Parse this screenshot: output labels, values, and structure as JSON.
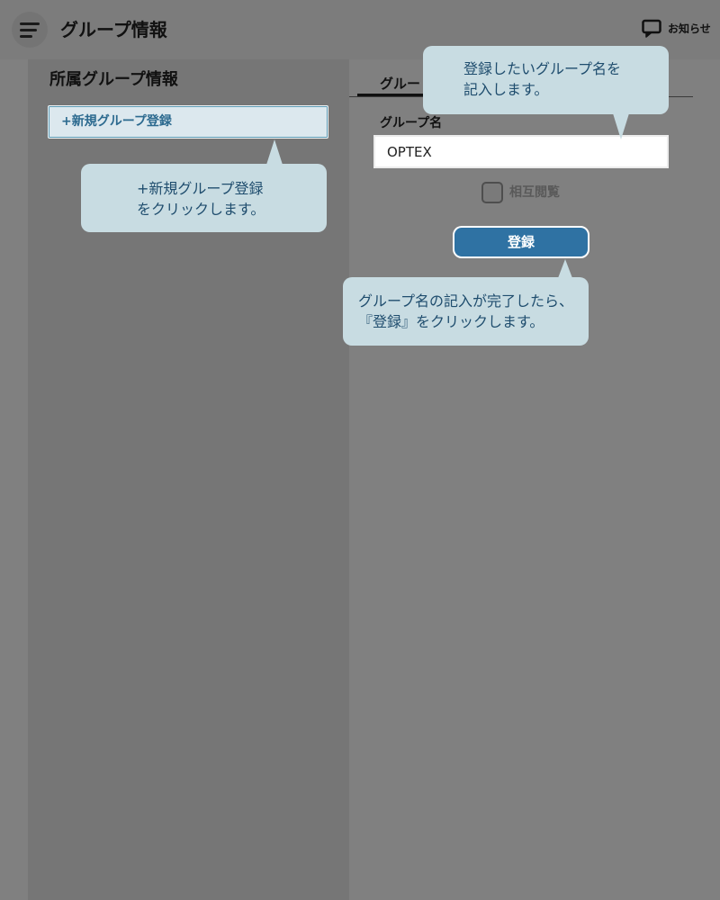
{
  "header": {
    "title": "グループ情報",
    "notice_label": "お知らせ",
    "menu_icon": "hamburger-icon",
    "notice_icon": "chat-bubble-icon"
  },
  "sidebar": {
    "title": "所属グループ情報",
    "new_group_button": "+新規グループ登録"
  },
  "main": {
    "tab_label": "グルー",
    "group_name_label": "グループ名",
    "group_name_value": "OPTEX",
    "mutual_view_label": "相互閲覧",
    "mutual_view_checked": false,
    "submit_label": "登録"
  },
  "callouts": {
    "new_group": {
      "lines": [
        "+新規グループ登録",
        "をクリックします。"
      ]
    },
    "group_name": {
      "lines": [
        "登録したいグループ名を",
        "記入します。"
      ]
    },
    "submit": {
      "lines": [
        "グループ名の記入が完了したら、",
        "『登録』をクリックします。"
      ]
    }
  },
  "colors": {
    "accent": "#2f72a3",
    "callout_bg": "#c8dce2",
    "callout_text": "#1f4d6e",
    "overlay": "#808080"
  }
}
